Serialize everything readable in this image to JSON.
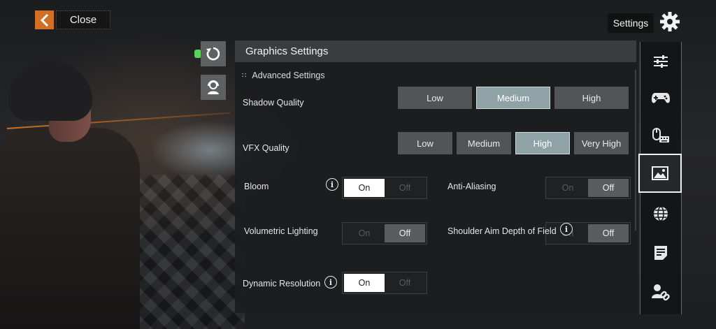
{
  "top_bar": {
    "close_label": "Close",
    "settings_label": "Settings"
  },
  "panel": {
    "title": "Graphics Settings",
    "section": "Advanced Settings"
  },
  "settings": {
    "shadow_quality": {
      "label": "Shadow Quality",
      "options": [
        "Low",
        "Medium",
        "High"
      ],
      "selected": "Medium"
    },
    "vfx_quality": {
      "label": "VFX Quality",
      "options": [
        "Low",
        "Medium",
        "High",
        "Very High"
      ],
      "selected": "High"
    },
    "bloom": {
      "label": "Bloom",
      "on": "On",
      "off": "Off",
      "value": "On"
    },
    "anti_aliasing": {
      "label": "Anti-Aliasing",
      "on": "On",
      "off": "Off",
      "value": "Off"
    },
    "volumetric_lighting": {
      "label": "Volumetric Lighting",
      "on": "On",
      "off": "Off",
      "value": "Off"
    },
    "shoulder_aim_dof": {
      "label": "Shoulder Aim Depth of Field",
      "on": "On",
      "off": "Off",
      "value": "Off"
    },
    "dynamic_resolution": {
      "label": "Dynamic Resolution",
      "on": "On",
      "off": "Off",
      "value": "On"
    }
  },
  "icons": {
    "info": "i"
  },
  "sidenav": [
    {
      "icon": "sliders-icon",
      "active": false
    },
    {
      "icon": "gamepad-icon",
      "active": false
    },
    {
      "icon": "mouse-keyboard-icon",
      "active": false
    },
    {
      "icon": "image-icon",
      "active": true
    },
    {
      "icon": "globe-icon",
      "active": false
    },
    {
      "icon": "notes-icon",
      "active": false
    },
    {
      "icon": "account-link-icon",
      "active": false
    }
  ],
  "colors": {
    "accent_orange": "#d06f25",
    "selected_option": "#8fa3a7",
    "option_bg": "#525456",
    "panel_header": "#3b3c3e"
  }
}
